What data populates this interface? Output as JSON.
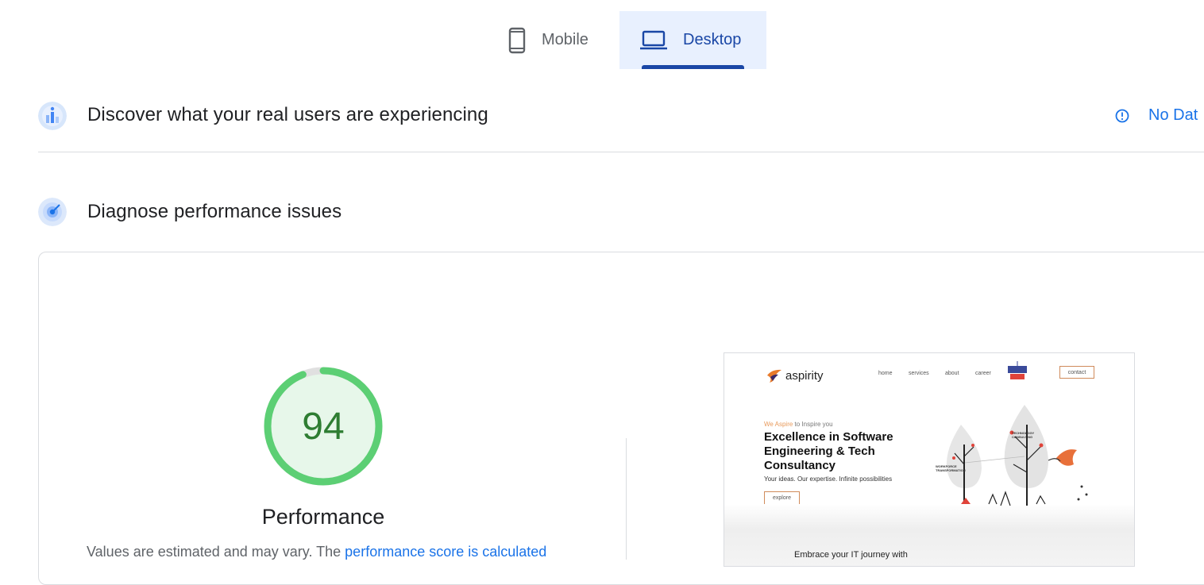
{
  "tabs": {
    "mobile": "Mobile",
    "desktop": "Desktop"
  },
  "field_section": {
    "title": "Discover what your real users are experiencing",
    "status": "No Dat"
  },
  "lab_section": {
    "title": "Diagnose performance issues"
  },
  "performance": {
    "score": "94",
    "score_value": 94,
    "label": "Performance",
    "note_prefix": "Values are estimated and may vary. The ",
    "note_link": "performance score is calculated"
  },
  "screenshot": {
    "brand": "aspirity",
    "nav": [
      "home",
      "services",
      "about",
      "career"
    ],
    "contact": "contact",
    "tagline_accent": "We Aspire",
    "tagline_rest": " to Inspire you",
    "headline": "Excellence in Software Engineering & Tech Consultancy",
    "subline": "Your ideas. Our expertise. Infinite possibilities",
    "button": "explore",
    "labels": {
      "technology": "TECHNOLOGY CONSULTING",
      "workforce": "WORKFORCE TRANSFORMATION"
    },
    "footer_text": "Embrace your IT journey with"
  },
  "colors": {
    "accent": "#1a47a6",
    "link": "#1a73e8",
    "pass": "#0cce6b"
  }
}
